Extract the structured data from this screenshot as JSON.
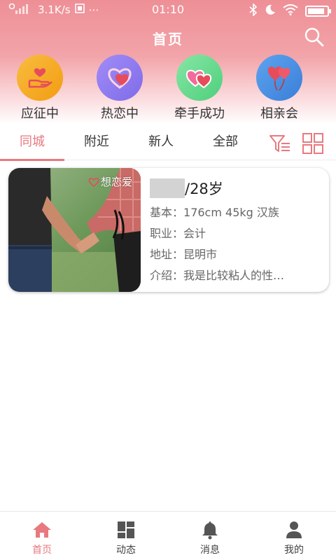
{
  "status_bar": {
    "net_speed": "3.1K/s",
    "more": "⋯",
    "time": "01:10",
    "battery_level": 0.9
  },
  "header": {
    "title": "首页"
  },
  "categories": [
    {
      "label": "应征中",
      "icon": "hand-heart-icon",
      "color": "#f5a623"
    },
    {
      "label": "热恋中",
      "icon": "hearts-icon",
      "color": "#8e7cf0"
    },
    {
      "label": "牵手成功",
      "icon": "double-heart-icon",
      "color": "#6cd88f"
    },
    {
      "label": "相亲会",
      "icon": "heart-balloons-icon",
      "color": "#4a90e2"
    }
  ],
  "tabs": [
    {
      "label": "同城",
      "active": true
    },
    {
      "label": "附近",
      "active": false
    },
    {
      "label": "新人",
      "active": false
    },
    {
      "label": "全部",
      "active": false
    }
  ],
  "tab_tools": {
    "filter_icon": "filter-icon",
    "grid_icon": "grid-view-icon"
  },
  "cards": [
    {
      "badge": "想恋爱",
      "age": "/28岁",
      "basic_label": "基本：",
      "basic": "176cm 45kg 汉族",
      "job_label": "职业：",
      "job": "会计",
      "address_label": "地址：",
      "address": "昆明市",
      "intro_label": "介绍：",
      "intro": "我是比较粘人的性…"
    }
  ],
  "bottom_nav": [
    {
      "label": "首页",
      "icon": "home-icon",
      "active": true
    },
    {
      "label": "动态",
      "icon": "dashboard-icon",
      "active": false
    },
    {
      "label": "消息",
      "icon": "bell-icon",
      "active": false
    },
    {
      "label": "我的",
      "icon": "person-icon",
      "active": false
    }
  ],
  "colors": {
    "accent": "#e8797f",
    "header_top": "#ee8f96"
  }
}
